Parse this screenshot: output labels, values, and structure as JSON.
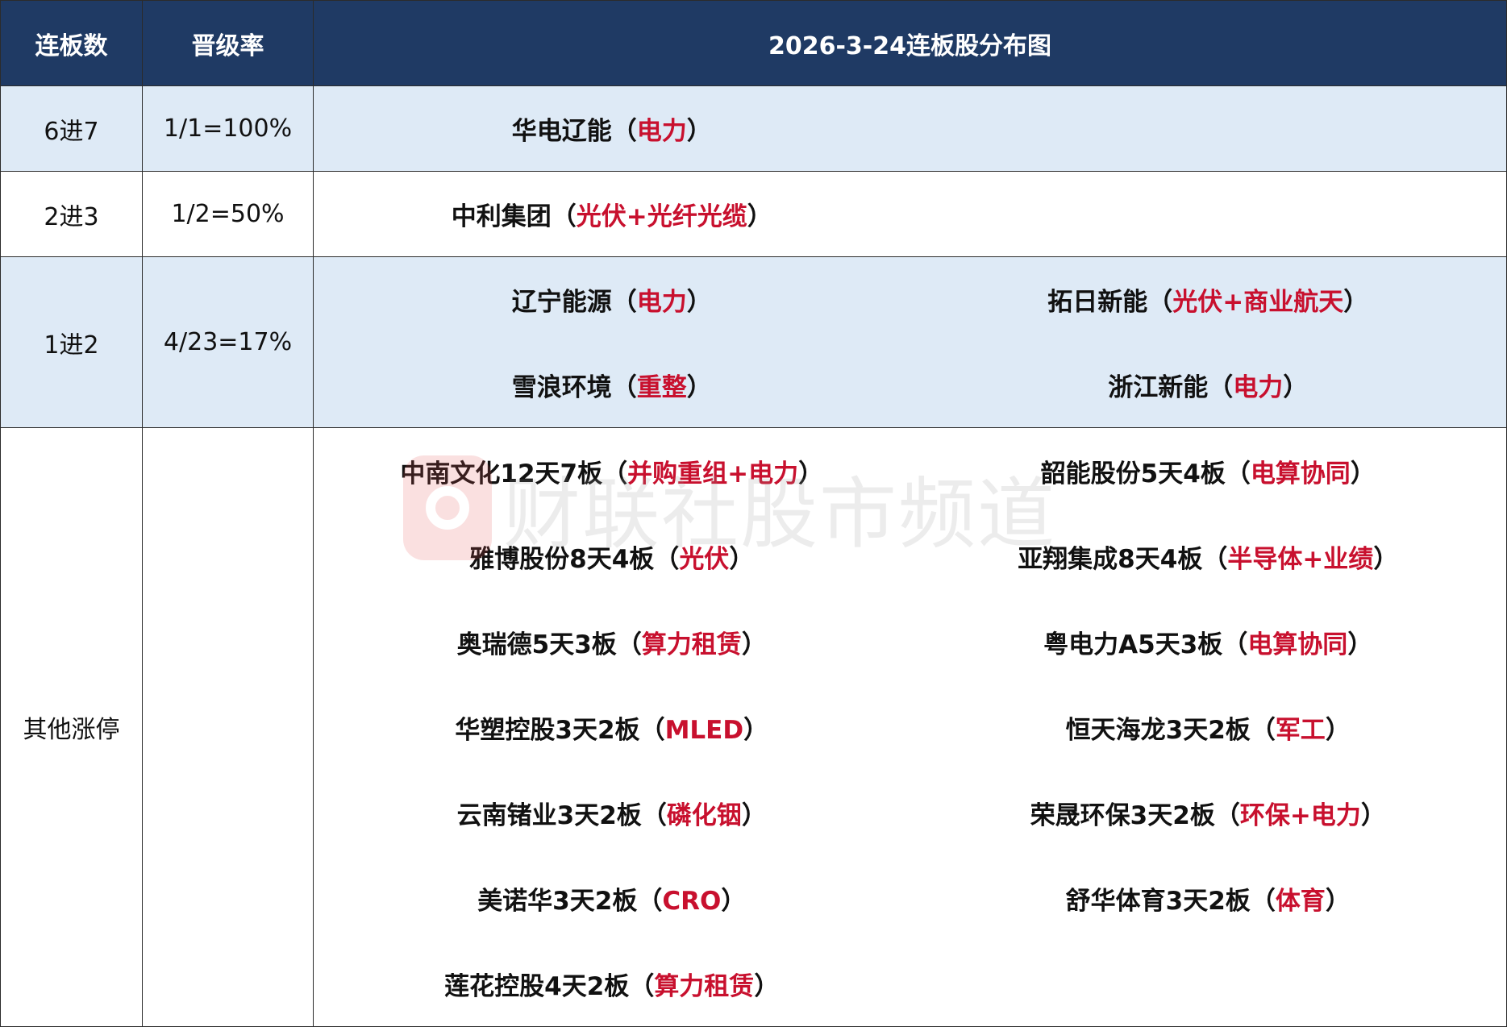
{
  "header": {
    "col1": "连板数",
    "col2": "晋级率",
    "title": "2026-3-24连板股分布图"
  },
  "rows": [
    {
      "level": "6进7",
      "rate": "1/1=100%",
      "entries": [
        {
          "name": "华电辽能",
          "tag": "电力"
        }
      ]
    },
    {
      "level": "2进3",
      "rate": "1/2=50%",
      "entries": [
        {
          "name": "中利集团",
          "tag": "光伏+光纤光缆"
        }
      ]
    },
    {
      "level": "1进2",
      "rate": "4/23=17%",
      "entries": [
        {
          "name": "辽宁能源",
          "tag": "电力"
        },
        {
          "name": "拓日新能",
          "tag": "光伏+商业航天"
        },
        {
          "name": "雪浪环境",
          "tag": "重整"
        },
        {
          "name": "浙江新能",
          "tag": "电力"
        }
      ]
    },
    {
      "level": "其他涨停",
      "rate": "",
      "entries": [
        {
          "name": "中南文化12天7板",
          "tag": "并购重组+电力"
        },
        {
          "name": "韶能股份5天4板",
          "tag": "电算协同"
        },
        {
          "name": "雅博股份8天4板",
          "tag": "光伏"
        },
        {
          "name": "亚翔集成8天4板",
          "tag": "半导体+业绩"
        },
        {
          "name": "奥瑞德5天3板",
          "tag": "算力租赁"
        },
        {
          "name": "粤电力A5天3板",
          "tag": "电算协同"
        },
        {
          "name": "华塑控股3天2板",
          "tag": "MLED"
        },
        {
          "name": "恒天海龙3天2板",
          "tag": "军工"
        },
        {
          "name": "云南锗业3天2板",
          "tag": "磷化铟"
        },
        {
          "name": "荣晟环保3天2板",
          "tag": "环保+电力"
        },
        {
          "name": "美诺华3天2板",
          "tag": "CRO"
        },
        {
          "name": "舒华体育3天2板",
          "tag": "体育"
        },
        {
          "name": "莲花控股4天2板",
          "tag": "算力租赁"
        }
      ]
    }
  ],
  "watermark": {
    "text": "财联社股市频道",
    "logo_icon": "cls-logo-icon"
  },
  "colors": {
    "header_bg": "#1f3a64",
    "row_blue": "#deeaf6",
    "tag_red": "#c8102e"
  }
}
